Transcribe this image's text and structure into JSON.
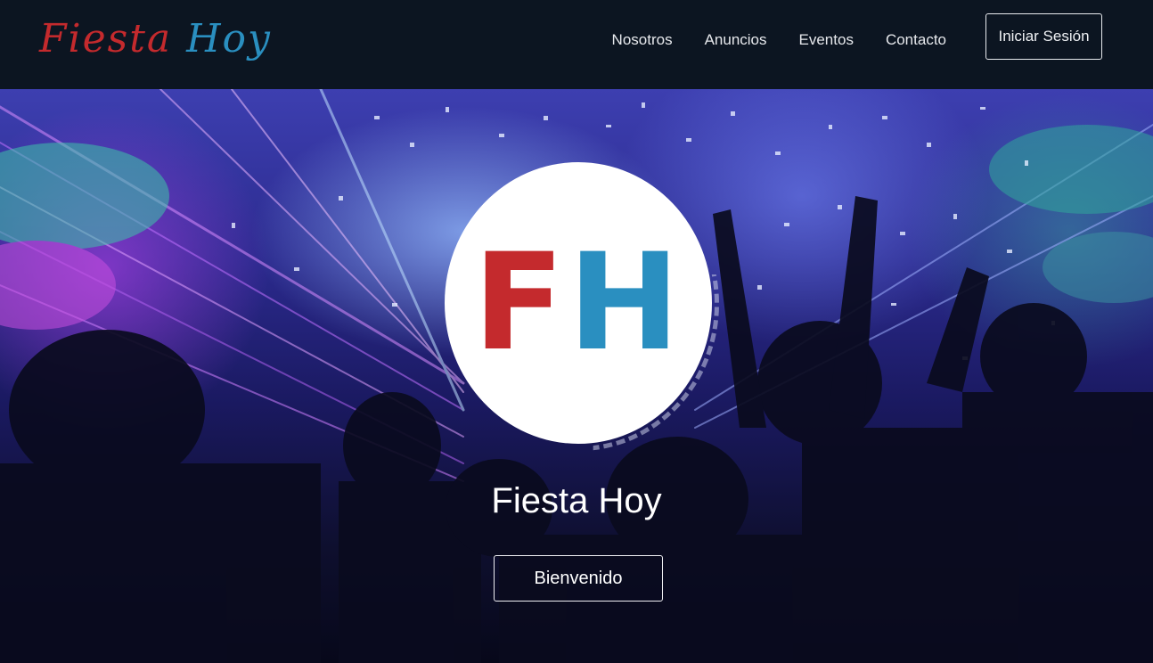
{
  "brand": {
    "word1": "Fiesta",
    "word2": "Hoy",
    "color1": "#c42a2d",
    "color2": "#2a8fc0"
  },
  "nav": {
    "links": [
      "Nosotros",
      "Anuncios",
      "Eventos",
      "Contacto"
    ],
    "login_label": "Iniciar Sesión"
  },
  "hero": {
    "logo": {
      "letter1": "F",
      "letter2": "H"
    },
    "title": "Fiesta Hoy",
    "button_label": "Bienvenido"
  }
}
